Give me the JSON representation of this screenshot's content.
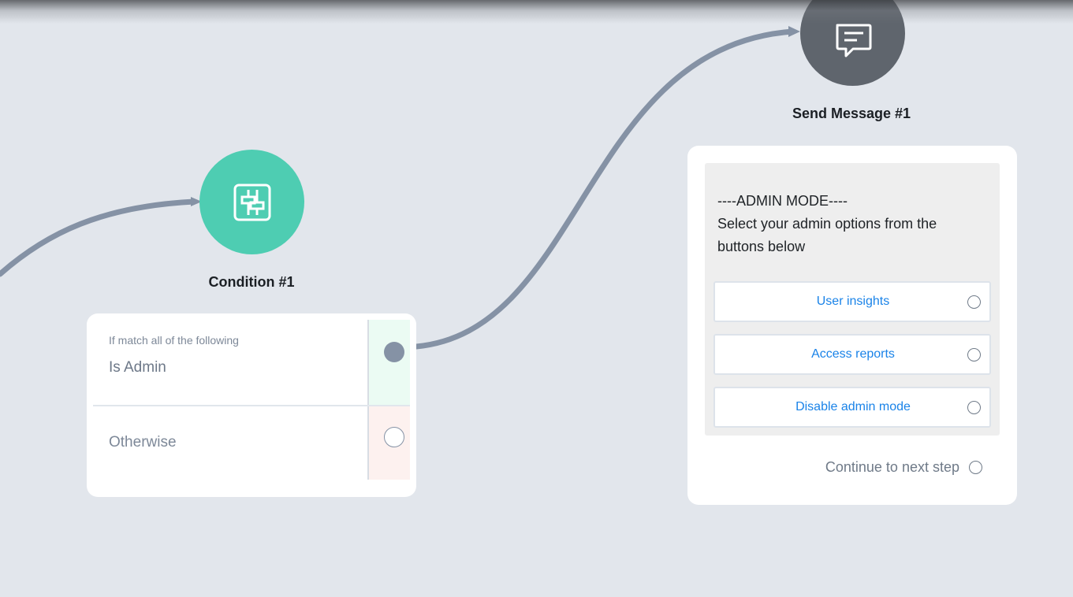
{
  "flow": {
    "condition_node": {
      "title": "Condition #1",
      "icon": "sliders-icon",
      "color": "#4ecdb2",
      "rule_caption": "If match all of the following",
      "rule_value": "Is Admin",
      "otherwise_label": "Otherwise"
    },
    "message_node": {
      "title": "Send Message #1",
      "icon": "chat-message-icon",
      "color": "#5f656d",
      "message_lines": [
        "----ADMIN MODE----",
        "Select your admin options from the buttons below"
      ],
      "buttons": [
        {
          "label": "User insights"
        },
        {
          "label": "Access reports"
        },
        {
          "label": "Disable admin mode"
        }
      ],
      "continue_label": "Continue to next step"
    },
    "colors": {
      "canvas": "#e2e6ec",
      "connector": "#8592a5",
      "button_text": "#1a83e8",
      "match_port_bg": "#ebfbf3",
      "otherwise_port_bg": "#fdf1ef"
    }
  }
}
